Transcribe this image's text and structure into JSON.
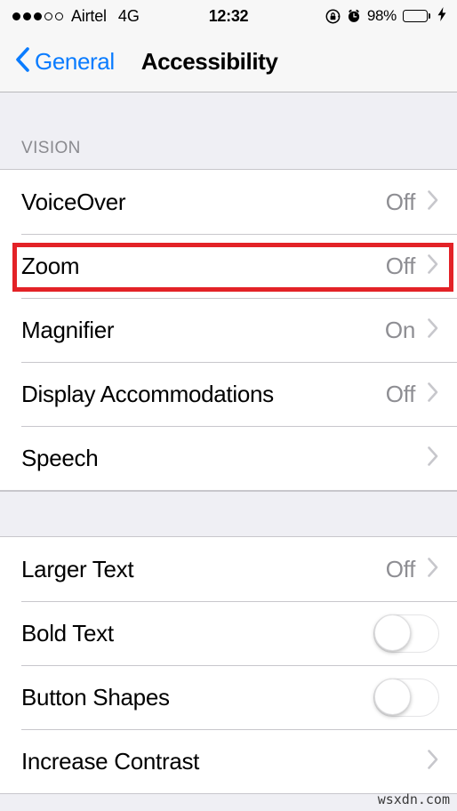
{
  "status_bar": {
    "signal_dots_filled": 3,
    "signal_dots_total": 5,
    "carrier": "Airtel",
    "network": "4G",
    "time": "12:32",
    "battery_percent": "98%",
    "battery_level": 100,
    "icons": [
      "rotation-lock-icon",
      "alarm-clock-icon",
      "battery-icon",
      "charging-bolt-icon"
    ],
    "colors": {
      "battery_fill": "#4cd964"
    }
  },
  "nav_bar": {
    "back_label": "General",
    "title": "Accessibility",
    "colors": {
      "tint": "#0a7cff"
    }
  },
  "sections": [
    {
      "header": "VISION",
      "rows": [
        {
          "label": "VoiceOver",
          "value": "Off",
          "accessory": "chevron"
        },
        {
          "label": "Zoom",
          "value": "Off",
          "accessory": "chevron",
          "highlighted": true
        },
        {
          "label": "Magnifier",
          "value": "On",
          "accessory": "chevron"
        },
        {
          "label": "Display Accommodations",
          "value": "Off",
          "accessory": "chevron"
        },
        {
          "label": "Speech",
          "value": "",
          "accessory": "chevron"
        }
      ]
    },
    {
      "header": "",
      "rows": [
        {
          "label": "Larger Text",
          "value": "Off",
          "accessory": "chevron"
        },
        {
          "label": "Bold Text",
          "value": "",
          "accessory": "toggle",
          "toggle_on": false
        },
        {
          "label": "Button Shapes",
          "value": "",
          "accessory": "toggle",
          "toggle_on": false
        },
        {
          "label": "Increase Contrast",
          "value": "",
          "accessory": "chevron"
        }
      ]
    }
  ],
  "annotation": {
    "highlight_color": "#e32227",
    "highlight_target": "Zoom"
  },
  "watermark": "wsxdn.com"
}
